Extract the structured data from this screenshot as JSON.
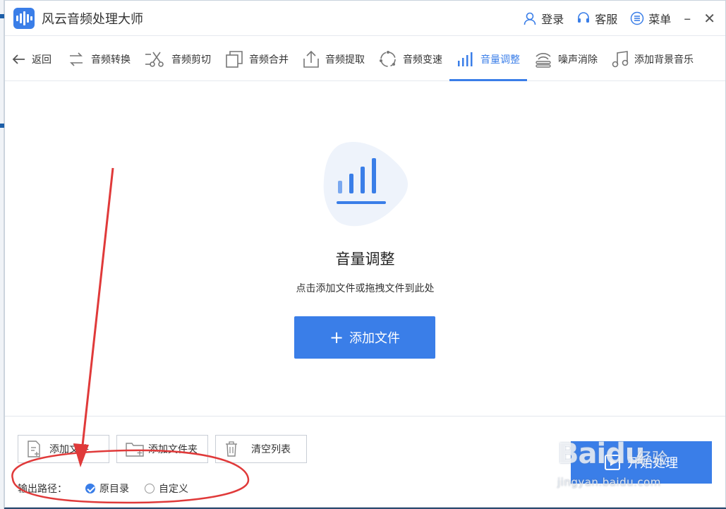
{
  "app": {
    "title": "风云音频处理大师",
    "accent": "#3a7ee8"
  },
  "titlebar": {
    "login": "登录",
    "service": "客服",
    "menu": "菜单",
    "minimize_icon": "minimize-icon",
    "close_icon": "close-icon"
  },
  "tabs": {
    "back": "返回",
    "items": [
      {
        "label": "音频转换",
        "icon": "convert-icon"
      },
      {
        "label": "音频剪切",
        "icon": "scissors-icon"
      },
      {
        "label": "音频合并",
        "icon": "merge-icon"
      },
      {
        "label": "音频提取",
        "icon": "extract-icon"
      },
      {
        "label": "音频变速",
        "icon": "speed-icon"
      },
      {
        "label": "音量调整",
        "icon": "volume-bars-icon",
        "active": true
      },
      {
        "label": "噪声消除",
        "icon": "noise-icon"
      },
      {
        "label": "添加背景音乐",
        "icon": "music-note-icon"
      }
    ]
  },
  "dropzone": {
    "title": "音量调整",
    "subtitle": "点击添加文件或拖拽文件到此处",
    "add_button": "添加文件"
  },
  "bottom": {
    "add_file": "添加文件",
    "add_folder": "添加文件夹",
    "clear_list": "清空列表",
    "output_label": "输出路径：",
    "option_original": "原目录",
    "option_custom": "自定义",
    "selected": "原目录",
    "start": "开始处理"
  },
  "watermark": {
    "logo": "Baidu",
    "cn": "经验",
    "url": "jingyan.baidu.com"
  }
}
